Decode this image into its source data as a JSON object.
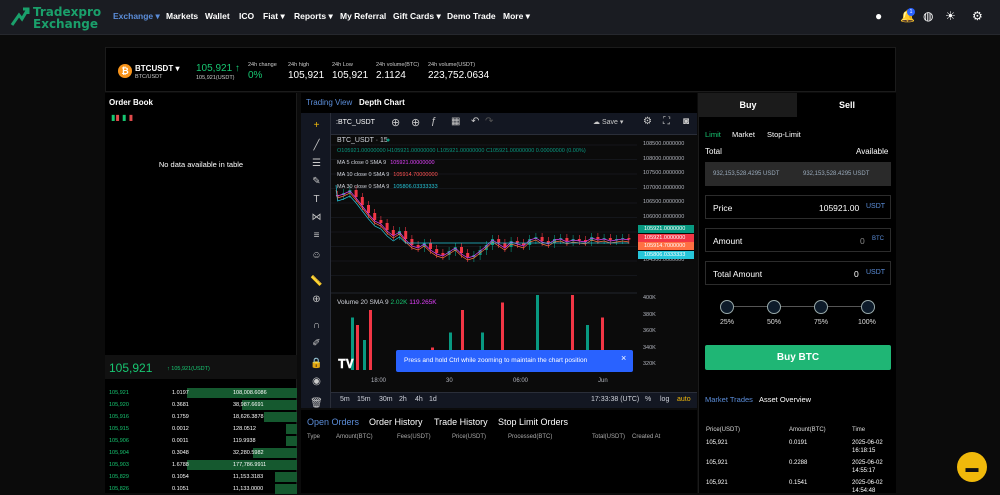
{
  "nav": {
    "brand_line1": "Tradexpro",
    "brand_line2": "Exchange",
    "items": [
      {
        "label": "Exchange",
        "caret": true,
        "active": true
      },
      {
        "label": "Markets"
      },
      {
        "label": "Wallet"
      },
      {
        "label": "ICO"
      },
      {
        "label": "Fiat",
        "caret": true
      },
      {
        "label": "Reports",
        "caret": true
      },
      {
        "label": "My Referral"
      },
      {
        "label": "Gift Cards",
        "caret": true
      },
      {
        "label": "Demo Trade"
      },
      {
        "label": "More",
        "caret": true
      }
    ],
    "notif_count": "1"
  },
  "pair": {
    "symbol": "BTCUSDT",
    "sub": "BTC/USDT",
    "price": "105,921",
    "price_sub": "105,921(USDT)",
    "change_label": "24h change",
    "change": "0%",
    "high_label": "24h high",
    "high": "105,921",
    "low_label": "24h Low",
    "low": "105,921",
    "volbtc_label": "24h volume(BTC)",
    "volbtc": "2.1124",
    "volusdt_label": "24h volume(USDT)",
    "volusdt": "223,752.0634"
  },
  "orderbook": {
    "title": "Order Book",
    "empty": "No data available in table",
    "last_price": "105,921",
    "last_sub": "105,921(USDT)",
    "rows": [
      [
        "105,921",
        "1.0197",
        "108,008.6086",
        1
      ],
      [
        "105,920",
        "0.3681",
        "38,987.6691",
        0.5
      ],
      [
        "105,916",
        "0.1759",
        "18,626.3878",
        0.3
      ],
      [
        "105,915",
        "0.0012",
        "128.0512",
        0.1
      ],
      [
        "105,906",
        "0.0011",
        "119.9938",
        0.1
      ],
      [
        "105,904",
        "0.3048",
        "32,280.5982",
        0.4
      ],
      [
        "105,903",
        "1.6788",
        "177,786.9911",
        1
      ],
      [
        "105,829",
        "0.1054",
        "11,153.3183",
        0.2
      ],
      [
        "105,826",
        "0.1051",
        "11,133.0000",
        0.2
      ]
    ]
  },
  "chart": {
    "tab_trading": "Trading View",
    "tab_depth": "Depth Chart",
    "save": "Save",
    "symbol": "BTC_USDT",
    "title": "BTC_USDT · 15",
    "ohlc": "O105921.00000000 H105921.00000000 L105921.00000000 C105921.00000000 0.00000000 (0.00%)",
    "ma": [
      {
        "label": "MA 5 close 0 SMA 9",
        "value": "105921.00000000",
        "color": "#e040fb"
      },
      {
        "label": "MA 10 close 0 SMA 9",
        "value": "105914.70000000",
        "color": "#ff5252"
      },
      {
        "label": "MA 30 close 0 SMA 9",
        "value": "105806.03333333",
        "color": "#26c6da"
      }
    ],
    "volume": "Volume 20 SMA 9",
    "vol1": "2.02K",
    "vol2": "119.265K",
    "yaxis": [
      "108500.0000000",
      "108000.0000000",
      "107500.0000000",
      "107000.0000000",
      "106500.0000000",
      "106000.0000000",
      "105500.0000000",
      "105000.0000000",
      "104500.0000000"
    ],
    "ytags": [
      {
        "v": "105921.0000000",
        "c": "#089981"
      },
      {
        "v": "105921.0000000",
        "c": "#f23645"
      },
      {
        "v": "105914.7000000",
        "c": "#ff7043"
      },
      {
        "v": "105806.0333333",
        "c": "#26c6da"
      }
    ],
    "volaxis": [
      "400K",
      "380K",
      "360K",
      "340K",
      "320K"
    ],
    "xaxis": [
      "18:00",
      "30",
      "06:00",
      "Jun"
    ],
    "ranges": [
      "5m",
      "15m",
      "30m",
      "2h",
      "4h",
      "1d"
    ],
    "time": "17:33:38 (UTC)",
    "pct": "%",
    "log": "log",
    "auto": "auto",
    "tooltip": "Press and hold Ctrl while zooming to maintain the chart position"
  },
  "orders": {
    "tabs": [
      "Open Orders",
      "Order History",
      "Trade History",
      "Stop Limit Orders"
    ],
    "cols": [
      "Type",
      "Amount(BTC)",
      "Fees(USDT)",
      "Price(USDT)",
      "Processed(BTC)",
      "Total(USDT)",
      "Created At"
    ]
  },
  "trade": {
    "buy": "Buy",
    "sell": "Sell",
    "types": [
      "Limit",
      "Market",
      "Stop-Limit"
    ],
    "total": "Total",
    "available": "Available",
    "bal1": "932,153,528.4295 USDT",
    "bal2": "932,153,528.4295 USDT",
    "price_label": "Price",
    "price_val": "105921.00",
    "price_unit": "USDT",
    "amount_label": "Amount",
    "amount_val": "0",
    "amount_unit": "BTC",
    "totalamt_label": "Total Amount",
    "totalamt_val": "0",
    "totalamt_unit": "USDT",
    "pcts": [
      "25%",
      "50%",
      "75%",
      "100%"
    ],
    "buy_btn": "Buy BTC",
    "mt_tab": "Market Trades",
    "ao_tab": "Asset Overview",
    "cols": [
      "Price(USDT)",
      "Amount(BTC)",
      "Time"
    ],
    "rows": [
      [
        "105,921",
        "0.0191",
        "2025-06-02",
        "16:18:15"
      ],
      [
        "105,921",
        "0.2288",
        "2025-06-02",
        "14:55:17"
      ],
      [
        "105,921",
        "0.1541",
        "2025-06-02",
        "14:54:48"
      ]
    ]
  }
}
